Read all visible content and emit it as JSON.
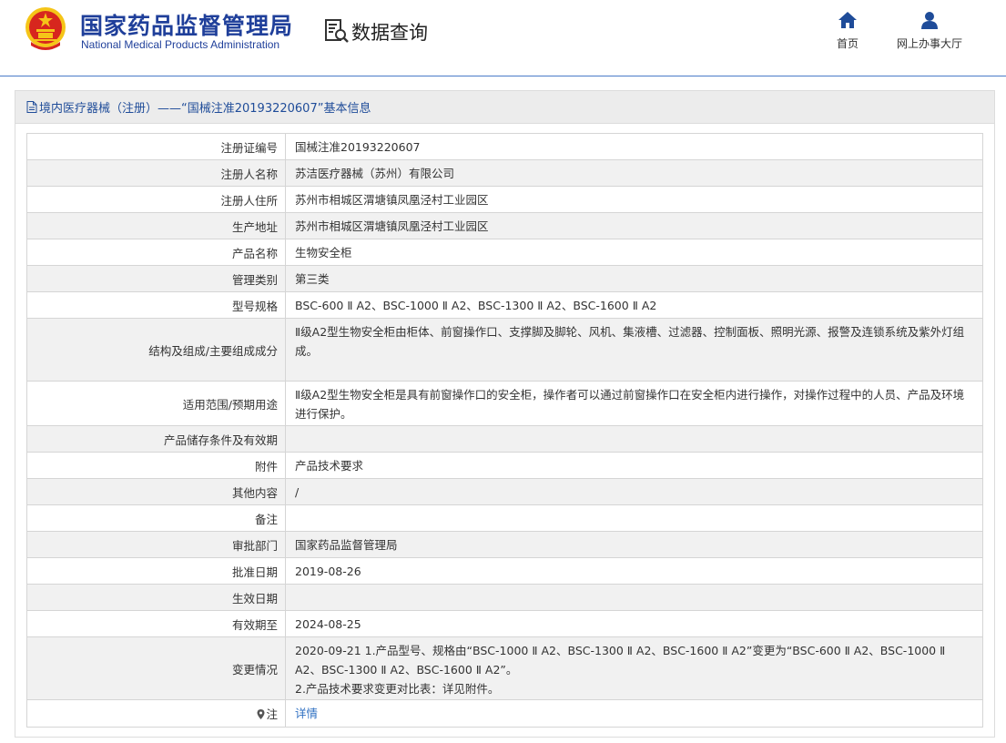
{
  "header": {
    "org_cn": "国家药品监督管理局",
    "org_en": "National Medical Products Administration",
    "section": "数据查询",
    "nav": [
      {
        "label": "首页",
        "icon": "home-icon"
      },
      {
        "label": "网上办事大厅",
        "icon": "user-icon"
      }
    ]
  },
  "panel": {
    "title": "境内医疗器械（注册）——“国械注准20193220607”基本信息"
  },
  "rows": [
    {
      "label": "注册证编号",
      "value": "国械注准20193220607"
    },
    {
      "label": "注册人名称",
      "value": "苏洁医疗器械（苏州）有限公司"
    },
    {
      "label": "注册人住所",
      "value": "苏州市相城区渭塘镇凤凰泾村工业园区"
    },
    {
      "label": "生产地址",
      "value": "苏州市相城区渭塘镇凤凰泾村工业园区"
    },
    {
      "label": "产品名称",
      "value": "生物安全柜"
    },
    {
      "label": "管理类别",
      "value": "第三类"
    },
    {
      "label": "型号规格",
      "value": "BSC-600 Ⅱ A2、BSC-1000 Ⅱ A2、BSC-1300 Ⅱ A2、BSC-1600 Ⅱ A2"
    },
    {
      "label": "结构及组成/主要组成成分",
      "value": "Ⅱ级A2型生物安全柜由柜体、前窗操作口、支撑脚及脚轮、风机、集液槽、过滤器、控制面板、照明光源、报警及连锁系统及紫外灯组成。"
    },
    {
      "label": "适用范围/预期用途",
      "value": "Ⅱ级A2型生物安全柜是具有前窗操作口的安全柜，操作者可以通过前窗操作口在安全柜内进行操作，对操作过程中的人员、产品及环境进行保护。"
    },
    {
      "label": "产品储存条件及有效期",
      "value": ""
    },
    {
      "label": "附件",
      "value": "产品技术要求"
    },
    {
      "label": "其他内容",
      "value": "/"
    },
    {
      "label": "备注",
      "value": ""
    },
    {
      "label": "审批部门",
      "value": "国家药品监督管理局"
    },
    {
      "label": "批准日期",
      "value": "2019-08-26"
    },
    {
      "label": "生效日期",
      "value": ""
    },
    {
      "label": "有效期至",
      "value": "2024-08-25"
    },
    {
      "label": "变更情况",
      "value": "2020-09-21 1.产品型号、规格由“BSC-1000 Ⅱ A2、BSC-1300 Ⅱ A2、BSC-1600 Ⅱ A2”变更为“BSC-600 Ⅱ A2、BSC-1000 Ⅱ A2、BSC-1300 Ⅱ A2、BSC-1600 Ⅱ A2”。\n2.产品技术要求变更对比表：详见附件。"
    }
  ],
  "note_row": {
    "label": "注",
    "link": "详情",
    "icon": "pin-icon"
  },
  "colors": {
    "brand": "#1f3f9a",
    "link": "#2e6fc2",
    "emblem_red": "#d7261e",
    "emblem_gold": "#f5c518"
  }
}
